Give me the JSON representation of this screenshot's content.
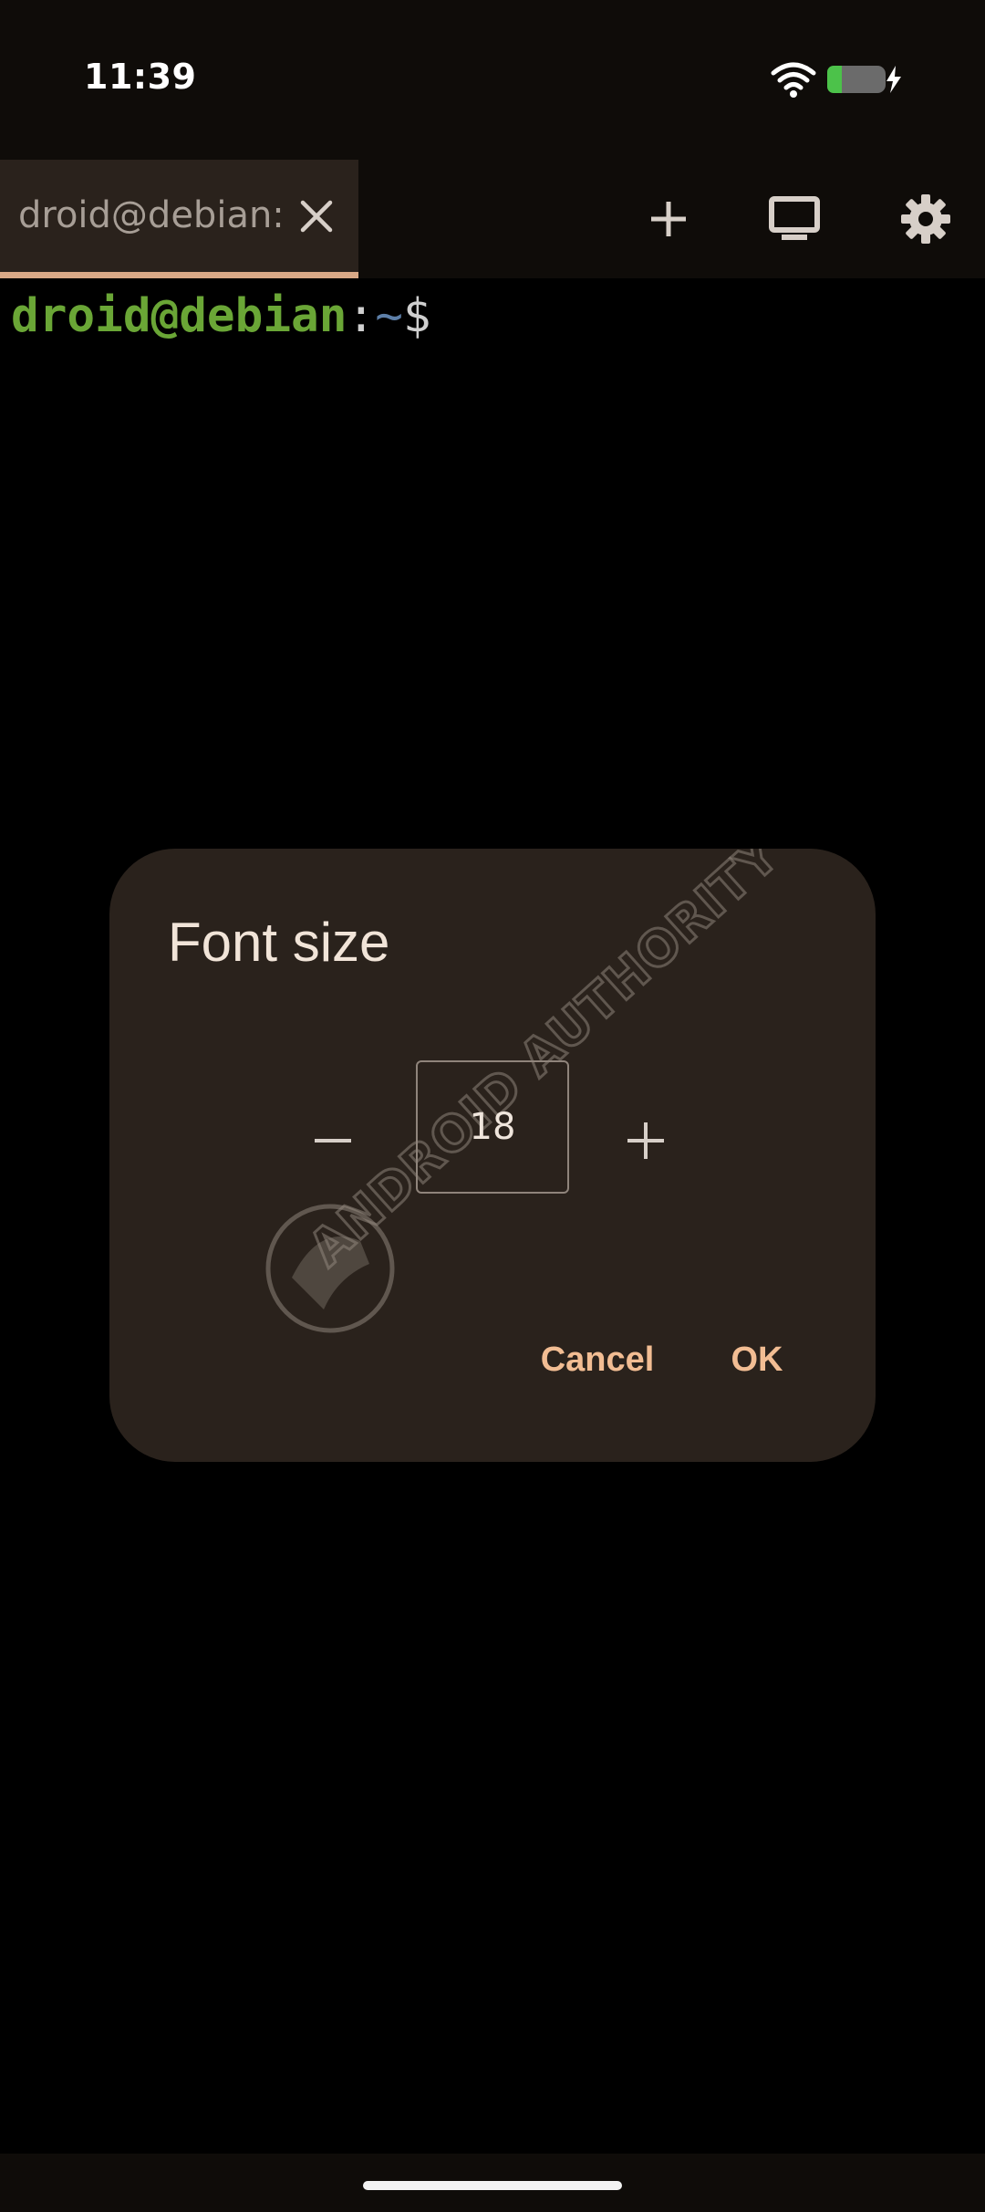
{
  "status_bar": {
    "time": "11:39"
  },
  "tabs": [
    {
      "label": "droid@debian:~"
    }
  ],
  "toolbar": {
    "add_icon": "add-icon",
    "display_icon": "display-icon",
    "settings_icon": "gear-icon"
  },
  "terminal": {
    "user_host": "droid@debian",
    "colon": ":",
    "path": "~",
    "dollar": "$"
  },
  "dialog": {
    "title": "Font size",
    "value": "18",
    "cancel_label": "Cancel",
    "ok_label": "OK"
  },
  "watermark": {
    "text": "ANDROID AUTHORITY"
  },
  "colors": {
    "accent": "#d9a987",
    "dialog_background": "#2a221c",
    "button_text": "#f2bd93",
    "prompt_user": "#6aa636",
    "prompt_path": "#5d7fa8",
    "battery": "#4cc24a"
  }
}
